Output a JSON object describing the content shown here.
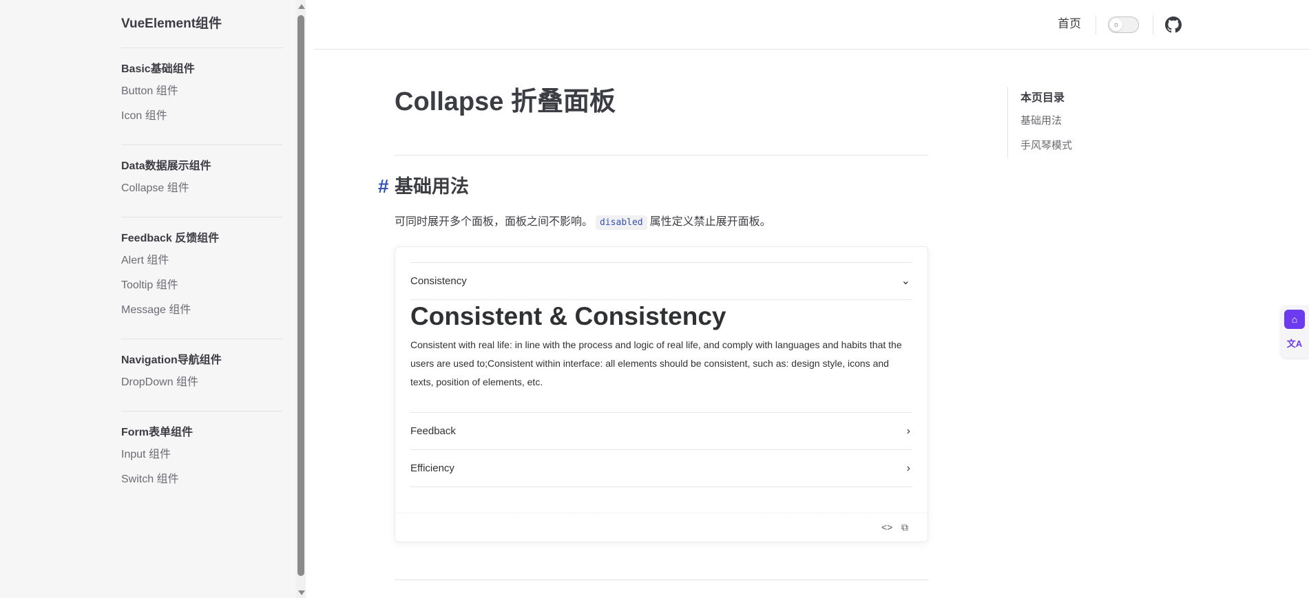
{
  "sidebar": {
    "site_title": "VueElement组件",
    "groups": [
      {
        "title": "Basic基础组件",
        "items": [
          "Button 组件",
          "Icon 组件"
        ]
      },
      {
        "title": "Data数据展示组件",
        "items": [
          "Collapse 组件"
        ]
      },
      {
        "title": "Feedback 反馈组件",
        "items": [
          "Alert 组件",
          "Tooltip 组件",
          "Message 组件"
        ]
      },
      {
        "title": "Navigation导航组件",
        "items": [
          "DropDown 组件"
        ]
      },
      {
        "title": "Form表单组件",
        "items": [
          "Input 组件",
          "Switch 组件"
        ]
      }
    ]
  },
  "topnav": {
    "home": "首页",
    "theme_icon": "sun-icon",
    "github_icon": "github-icon"
  },
  "main": {
    "title": "Collapse 折叠面板",
    "section_anchor": "#",
    "section_title": "基础用法",
    "desc_before": "可同时展开多个面板，面板之间不影响。",
    "desc_code": "disabled",
    "desc_after": "属性定义禁止展开面板。",
    "collapse": {
      "items": [
        {
          "title": "Consistency",
          "expanded": true
        },
        {
          "title": "Feedback",
          "expanded": false
        },
        {
          "title": "Efficiency",
          "expanded": false
        }
      ],
      "body_title": "Consistent & Consistency",
      "body_text": "Consistent with real life: in line with the process and logic of real life, and comply with languages and habits that the users are used to;Consistent within interface: all elements should be consistent, such as: design style, icons and texts, position of elements, etc."
    },
    "footer_icons": [
      "code-icon",
      "copy-icon"
    ]
  },
  "outline": {
    "title": "本页目录",
    "items": [
      "基础用法",
      "手风琴模式"
    ]
  },
  "colors": {
    "brand": "#3451b2",
    "widget": "#6c3bf0"
  }
}
